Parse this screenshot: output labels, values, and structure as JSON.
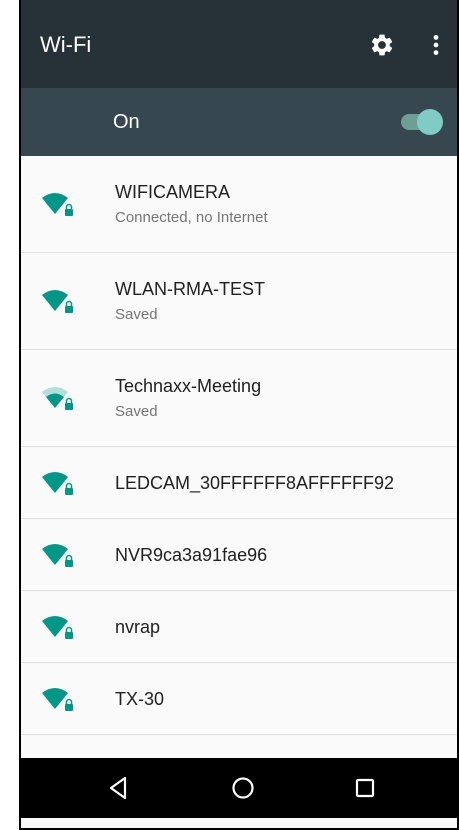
{
  "app": {
    "title": "Wi-Fi"
  },
  "toolbar": {
    "settings_icon": "gear-icon",
    "overflow_icon": "more-vert-icon"
  },
  "master_switch": {
    "label": "On",
    "state": true
  },
  "networks": [
    {
      "ssid": "WIFICAMERA",
      "status": "Connected, no Internet",
      "signal": 1.0,
      "secured": true
    },
    {
      "ssid": "WLAN-RMA-TEST",
      "status": "Saved",
      "signal": 1.0,
      "secured": true
    },
    {
      "ssid": "Technaxx-Meeting",
      "status": "Saved",
      "signal": 0.6,
      "secured": true
    },
    {
      "ssid": "LEDCAM_30FFFFFF8AFFFFFF92",
      "status": "",
      "signal": 1.0,
      "secured": true
    },
    {
      "ssid": "NVR9ca3a91fae96",
      "status": "",
      "signal": 1.0,
      "secured": true
    },
    {
      "ssid": "nvrap",
      "status": "",
      "signal": 1.0,
      "secured": true
    },
    {
      "ssid": "TX-30",
      "status": "",
      "signal": 1.0,
      "secured": true
    }
  ],
  "nav": {
    "back_icon": "back-triangle-icon",
    "home_icon": "home-circle-icon",
    "recent_icon": "recent-square-icon"
  },
  "colors": {
    "appbar": "#263238",
    "switchbar": "#37474f",
    "accent": "#009688",
    "toggle_thumb": "#80cbc4"
  }
}
